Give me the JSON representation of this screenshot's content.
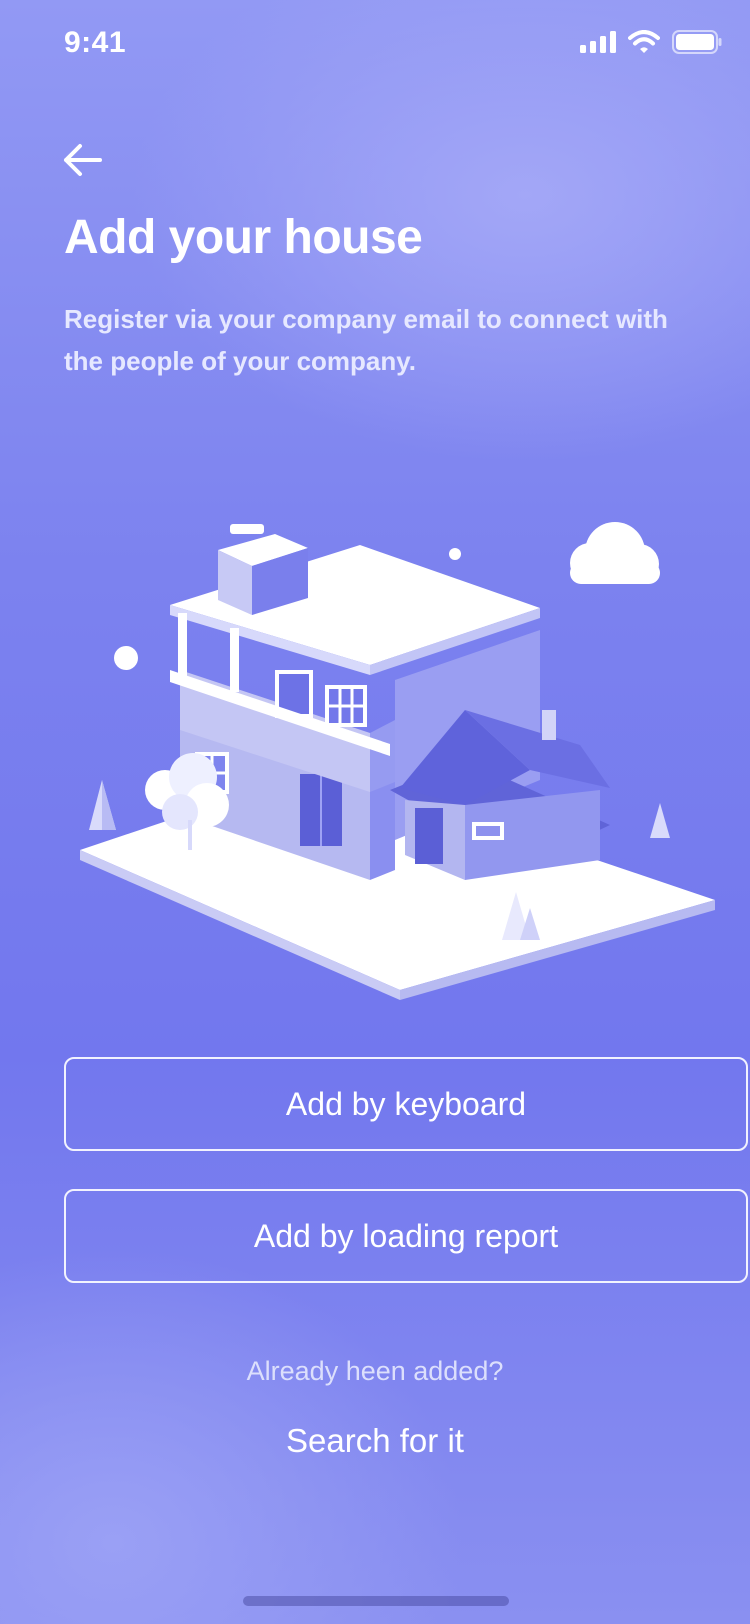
{
  "status_bar": {
    "time": "9:41",
    "signal_icon": "signal-bars-icon",
    "wifi_icon": "wifi-icon",
    "battery_icon": "battery-icon"
  },
  "nav": {
    "back_icon": "arrow-left-icon"
  },
  "header": {
    "title": "Add your house",
    "subtitle": "Register via your company email to connect with the people of your company."
  },
  "illustration": {
    "icon": "isometric-house-illustration"
  },
  "actions": {
    "keyboard_label": "Add by keyboard",
    "report_label": "Add by loading report"
  },
  "footer": {
    "prompt": "Already heen added?",
    "search_label": "Search for it"
  },
  "colors": {
    "accent": "#7a80ee",
    "text": "#ffffff"
  }
}
